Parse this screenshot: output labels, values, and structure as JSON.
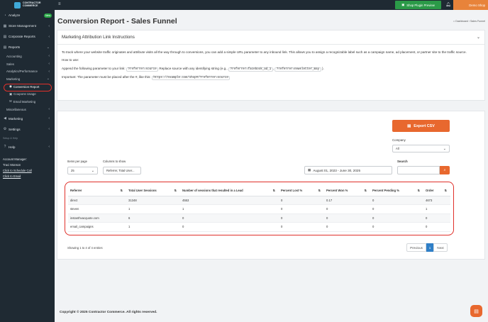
{
  "brand": {
    "line1": "CONTRACTOR",
    "line2": "COMMERCE"
  },
  "sidebar": {
    "analyze": "Analyze",
    "new_badge": "New",
    "store_management": "Store Management",
    "corporate_reports": "Corporate Reports",
    "reports": "Reports",
    "accounting": "Accounting",
    "sales": "Sales",
    "analytics_performance": "Analytics/Performance",
    "marketing_sub": "Marketing",
    "conversion_report": "Conversion Report",
    "coupons_usage": "Coupons Usage",
    "email_marketing_sub": "Email Marketing",
    "miscellaneous": "Miscellaneous",
    "marketing": "Marketing",
    "settings": "Settings",
    "section_label": "Setup & Help",
    "help": "Help",
    "account_manager_label": "Account Manager:",
    "account_manager_name": "Traci Monson",
    "schedule_call": "Click to Schedule Call",
    "email": "Click to Email"
  },
  "topbar": {
    "shop_preview": "Shop Plugin Preview",
    "shop_name": "Demo Shop"
  },
  "page": {
    "title": "Conversion Report - Sales Funnel",
    "breadcrumb_home": "Dashboard",
    "breadcrumb_current": "Sales Funnel"
  },
  "instructions": {
    "header": "Marketing Attribution Link Instructions",
    "para1": "To track where your website traffic originates and attribute visits all the way through to conversions, you can add a simple URL parameter to any inbound link. This allows you to assign a recognizable label such as a campaign name, ad placement, or partner site to the traffic source.",
    "how_to": "How to use:",
    "append_pre": "Append the following parameter to your link:",
    "param": "?referrer=source",
    "append_mid": "Replace source with any identifying string (e.g.,",
    "ex1": "?referrer=facebook_ad_1",
    "ex2": "?referrer=newsletter_may",
    "append_post": ").",
    "important_pre": "Important: The parameter must be placed after the #, like this:",
    "important_url": "https://example.com/shop#/?referrer=source"
  },
  "controls": {
    "export_csv": "Export CSV",
    "company_label": "Company",
    "company_value": "All",
    "items_per_page_label": "Items per page",
    "items_per_page_value": "25",
    "columns_label": "Columns to show",
    "columns_value": "Referrer, Total User...",
    "date_range": "August 01, 2023 - June 30, 2025",
    "search_label": "Search"
  },
  "table": {
    "headers": [
      "Referrer",
      "Total User Sessions",
      "Number of sessions that resulted in a Lead",
      "Percent Lost %",
      "Percent Won %",
      "Percent Pending %",
      "Order"
    ],
    "rows": [
      [
        "direct",
        "31348",
        "4553",
        "0",
        "0.17",
        "0",
        "4673"
      ],
      [
        "steven",
        "1",
        "1",
        "0",
        "0",
        "0",
        "1"
      ],
      [
        "instanthvacquote.com",
        "6",
        "0",
        "0",
        "0",
        "0",
        "0"
      ],
      [
        "email_campaigns",
        "1",
        "0",
        "0",
        "0",
        "0",
        "0"
      ]
    ]
  },
  "pagination": {
    "showing": "Showing 1 to 4 of 4 entries",
    "prev": "Previous",
    "page": "1",
    "next": "Next"
  },
  "footer": {
    "copyright": "Copyright © 2025 Contractor Commerce. All rights reserved."
  },
  "colors": {
    "accent": "#e8682e",
    "sidebar_bg": "#1f2a33",
    "highlight_ring": "#e0302a",
    "preview_green": "#2b9a48"
  }
}
